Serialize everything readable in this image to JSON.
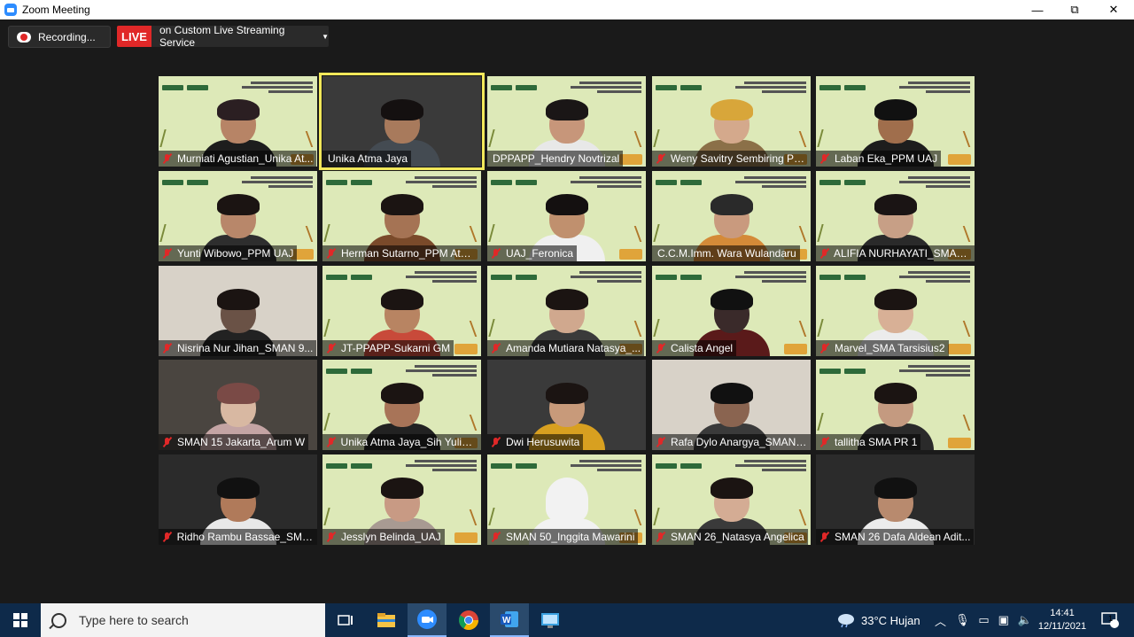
{
  "window": {
    "title": "Zoom Meeting",
    "controls": [
      "—",
      "⧉",
      "✕"
    ]
  },
  "top_controls": {
    "recording_label": "Recording...",
    "live_label": "LIVE",
    "stream_label": "on Custom Live Streaming Service"
  },
  "participants": [
    {
      "name": "Murniati Agustian_Unika At...",
      "muted": true,
      "slide_bg": true,
      "skin": "#b78466",
      "hair": "#2b1f22",
      "body": "#1d1d1d"
    },
    {
      "name": "Unika Atma Jaya",
      "muted": false,
      "active_speaker": true,
      "slide_bg": false,
      "skin": "#a87a5c",
      "hair": "#141010",
      "body": "#444b52"
    },
    {
      "name": "DPPAPP_Hendry Novtrizal",
      "muted": false,
      "slide_bg": true,
      "skin": "#c7967a",
      "hair": "#1a1616",
      "body": "#e8e8e8"
    },
    {
      "name": "Weny Savitry Sembiring Pa...",
      "muted": true,
      "slide_bg": true,
      "skin": "#d4a98c",
      "hair": "#d8a63a",
      "body": "#8b7048"
    },
    {
      "name": "Laban Eka_PPM UAJ",
      "muted": true,
      "slide_bg": true,
      "skin": "#a06e4c",
      "hair": "#111",
      "body": "#1d1d1d"
    },
    {
      "name": "Yunti Wibowo_PPM UAJ",
      "muted": true,
      "slide_bg": true,
      "skin": "#b8876a",
      "hair": "#1b1412",
      "body": "#2e2e2e"
    },
    {
      "name": "Herman Sutarno_PPM Atm...",
      "muted": true,
      "slide_bg": true,
      "skin": "#a57354",
      "hair": "#1b1412",
      "body": "#7a4a2a"
    },
    {
      "name": "UAJ_Feronica",
      "muted": true,
      "slide_bg": true,
      "skin": "#c0906e",
      "hair": "#141010",
      "body": "#f0f0f0"
    },
    {
      "name": "C.C.M.Imm. Wara Wulandaru",
      "muted": false,
      "slide_bg": true,
      "skin": "#c99a7e",
      "hair": "#2a2a2a",
      "body": "#d48a38"
    },
    {
      "name": "ALIFIA NURHAYATI_SMAN 1...",
      "muted": true,
      "slide_bg": true,
      "skin": "#c79f86",
      "hair": "#1a1414",
      "body": "#2a2a2a"
    },
    {
      "name": "Nisrina Nur Jihan_SMAN 9...",
      "muted": true,
      "slide_bg": false,
      "skin": "#6a5246",
      "hair": "#1b1412",
      "body": "#222"
    },
    {
      "name": "JT-PPAPP-Sukarni GM",
      "muted": true,
      "slide_bg": true,
      "skin": "#b88462",
      "hair": "#1b1412",
      "body": "#c84a3a"
    },
    {
      "name": "Amanda Mutiara Natasya_...",
      "muted": true,
      "slide_bg": true,
      "skin": "#d0a88e",
      "hair": "#1b1412",
      "body": "#3a3a3a"
    },
    {
      "name": "Calista Angel",
      "muted": true,
      "slide_bg": true,
      "skin": "#3a2a2a",
      "hair": "#111",
      "body": "#5a1a1a"
    },
    {
      "name": "Marvel_SMA Tarsisius2",
      "muted": true,
      "slide_bg": true,
      "skin": "#d8b096",
      "hair": "#1b1412",
      "body": "#ececec"
    },
    {
      "name": "SMAN 15 Jakarta_Arum W",
      "muted": true,
      "slide_bg": false,
      "skin": "#d8b8a2",
      "hair": "#7a4a46",
      "body": "#c4a4a4"
    },
    {
      "name": "Unika Atma Jaya_Sih Yulian...",
      "muted": true,
      "slide_bg": true,
      "skin": "#a87458",
      "hair": "#1b1412",
      "body": "#222"
    },
    {
      "name": "Dwi Herusuwita",
      "muted": true,
      "slide_bg": false,
      "skin": "#c89a7a",
      "hair": "#1b1412",
      "body": "#d8a020"
    },
    {
      "name": "Rafa Dylo Anargya_SMAN ...",
      "muted": true,
      "slide_bg": false,
      "skin": "#8a6450",
      "hair": "#111",
      "body": "#3a3a3a"
    },
    {
      "name": "tallitha SMA PR 1",
      "muted": true,
      "slide_bg": true,
      "skin": "#c49a80",
      "hair": "#1b1412",
      "body": "#2a2a2a"
    },
    {
      "name": "Ridho Rambu Bassae_SMA...",
      "muted": true,
      "slide_bg": false,
      "skin": "#b07a5a",
      "hair": "#111",
      "body": "#e8e8e8"
    },
    {
      "name": "Jesslyn Belinda_UAJ",
      "muted": true,
      "slide_bg": true,
      "skin": "#c89a84",
      "hair": "#1b1412",
      "body": "#a89a92"
    },
    {
      "name": "SMAN 50_Inggita Mawarini",
      "muted": true,
      "slide_bg": true,
      "skin": "#c8a088",
      "hair": "#f2f2f2",
      "body": "#f2f2f2"
    },
    {
      "name": "SMAN 26_Natasya Angelica",
      "muted": true,
      "slide_bg": true,
      "skin": "#d4ac94",
      "hair": "#1b1412",
      "body": "#3a3a3a"
    },
    {
      "name": "SMAN 26 Dafa Aldean Adit...",
      "muted": true,
      "slide_bg": false,
      "skin": "#b88a6e",
      "hair": "#111",
      "body": "#ececec"
    }
  ],
  "taskbar": {
    "search_placeholder": "Type here to search",
    "apps": [
      "task-view-icon",
      "file-explorer-icon",
      "zoom-icon",
      "chrome-icon",
      "word-icon",
      "remote-desktop-icon"
    ],
    "weather": "33°C  Hujan",
    "time": "14:41",
    "date": "12/11/2021",
    "notification_count": "1"
  },
  "colors": {
    "live_red": "#e02828",
    "active_speaker_outline": "#f2e85a",
    "slide_green": "#dde9b8",
    "taskbar": "#0e2a4a"
  }
}
